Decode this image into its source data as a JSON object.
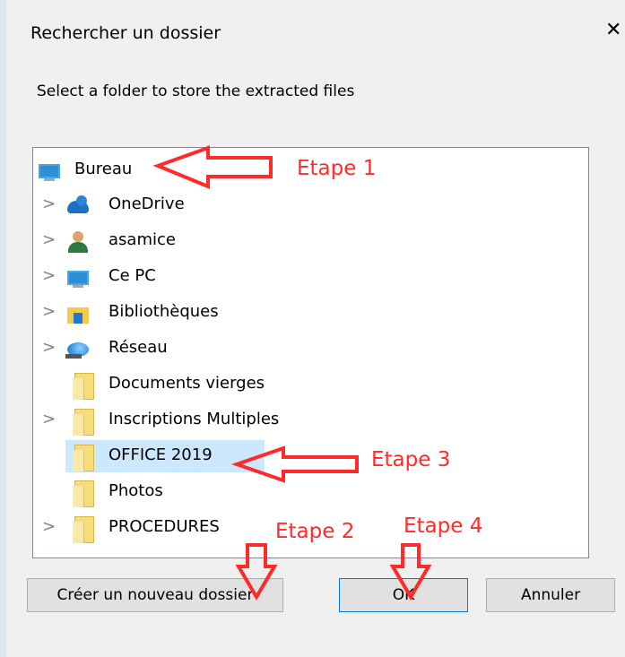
{
  "dialog": {
    "title": "Rechercher un dossier",
    "prompt": "Select a folder to store the extracted files",
    "close_glyph": "✕"
  },
  "tree": {
    "items": [
      {
        "label": "Bureau",
        "icon": "desktop-icon",
        "has_chevron": false,
        "selected": false
      },
      {
        "label": "OneDrive",
        "icon": "onedrive-cloud-icon",
        "has_chevron": true,
        "selected": false
      },
      {
        "label": "asamice",
        "icon": "user-icon",
        "has_chevron": true,
        "selected": false
      },
      {
        "label": "Ce PC",
        "icon": "computer-icon",
        "has_chevron": true,
        "selected": false
      },
      {
        "label": "Bibliothèques",
        "icon": "libraries-icon",
        "has_chevron": true,
        "selected": false
      },
      {
        "label": "Réseau",
        "icon": "network-icon",
        "has_chevron": true,
        "selected": false
      },
      {
        "label": "Documents vierges",
        "icon": "folder-icon",
        "has_chevron": false,
        "selected": false
      },
      {
        "label": "Inscriptions Multiples",
        "icon": "folder-icon",
        "has_chevron": true,
        "selected": false
      },
      {
        "label": "OFFICE 2019",
        "icon": "folder-icon",
        "has_chevron": false,
        "selected": true
      },
      {
        "label": "Photos",
        "icon": "folder-icon",
        "has_chevron": false,
        "selected": false
      },
      {
        "label": "PROCEDURES",
        "icon": "folder-icon",
        "has_chevron": true,
        "selected": false
      }
    ],
    "chevron_glyph": ">"
  },
  "buttons": {
    "new_folder": "Créer un nouveau dossier",
    "ok": "OK",
    "cancel": "Annuler"
  },
  "annotations": {
    "step1": "Etape 1",
    "step2": "Etape 2",
    "step3": "Etape 3",
    "step4": "Etape 4",
    "color": "#ff2a2a"
  }
}
